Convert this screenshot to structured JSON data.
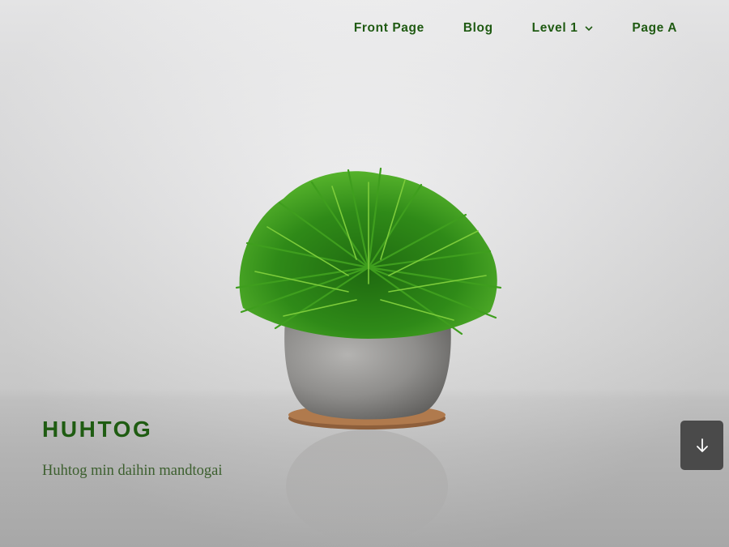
{
  "nav": {
    "items": [
      {
        "label": "Front Page"
      },
      {
        "label": "Blog"
      },
      {
        "label": "Level 1",
        "has_submenu": true,
        "icon": "chevron-down-icon"
      },
      {
        "label": "Page A"
      }
    ],
    "link_color": "#1f5a12"
  },
  "hero": {
    "site_title": "HUHTOG",
    "tagline": "Huhtog min daihin mandtogai",
    "title_color": "#1f5c12",
    "scroll_button": {
      "icon": "arrow-down-icon",
      "background": "#4a4a4a"
    }
  },
  "image": {
    "subject": "potted-plant-photo"
  }
}
